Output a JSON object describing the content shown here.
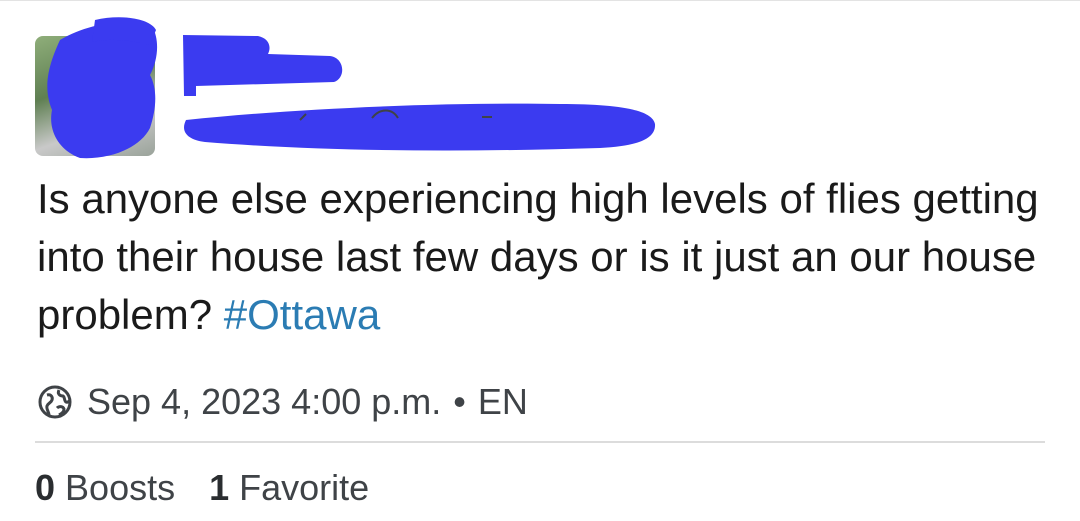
{
  "post": {
    "text": "Is anyone else experiencing high levels of flies getting into their house last few days or is it just an our house problem? ",
    "hashtag": "#Ottawa"
  },
  "meta": {
    "visibility_icon": "globe-icon",
    "timestamp": "Sep 4, 2023 4:00 p.m.",
    "separator": "•",
    "language": "EN"
  },
  "stats": {
    "boosts_count": "0",
    "boosts_label": "Boosts",
    "favorites_count": "1",
    "favorites_label": "Favorite"
  },
  "colors": {
    "hashtag": "#2b7cb3",
    "redaction": "#3b3bf0"
  }
}
